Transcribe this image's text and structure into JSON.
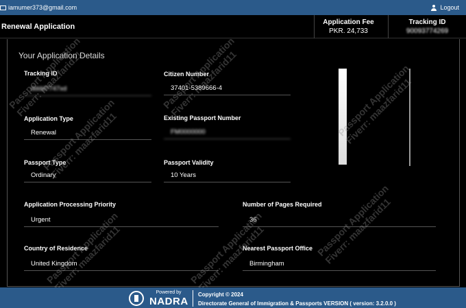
{
  "topbar": {
    "email": "iamumer373@gmail.com",
    "logout": "Logout"
  },
  "header": {
    "title": "Renewal Application",
    "fee_label": "Application Fee",
    "fee_value": "PKR. 24,733",
    "tracking_label": "Tracking ID",
    "tracking_value": "90093774269"
  },
  "details": {
    "section_title": "Your Application Details",
    "tracking_id": {
      "label": "Tracking ID",
      "value": "dddd7747xd"
    },
    "citizen_number": {
      "label": "Citizen Number",
      "value": "37401-5389666-4"
    },
    "application_type": {
      "label": "Application Type",
      "value": "Renewal"
    },
    "existing_passport": {
      "label": "Existing Passport Number",
      "value": "FM0000000"
    },
    "passport_type": {
      "label": "Passport Type",
      "value": "Ordinary"
    },
    "passport_validity": {
      "label": "Passport Validity",
      "value": "10 Years"
    },
    "priority": {
      "label": "Application Processing Priority",
      "value": "Urgent"
    },
    "pages": {
      "label": "Number of Pages Required",
      "value": "36"
    },
    "residence": {
      "label": "Country of Residence",
      "value": "United Kingdom"
    },
    "office": {
      "label": "Nearest Passport Office",
      "value": "Birmingham"
    }
  },
  "watermark": {
    "line1": "Passport Application",
    "line2": "Fiverr: maazfarid11"
  },
  "footer": {
    "powered_by": "Powered by",
    "nadra": "NADRA",
    "copyright": "Copyright © 2024",
    "directorate": "Directorate General of Immigration & Passports VERSION ( version: 3.2.0.0 )"
  },
  "colors": {
    "bar": "#2b5a8a",
    "background": "#000000"
  },
  "icons": {
    "email": "mail-icon",
    "logout": "user-icon",
    "footer_logo": "emblem-icon"
  }
}
